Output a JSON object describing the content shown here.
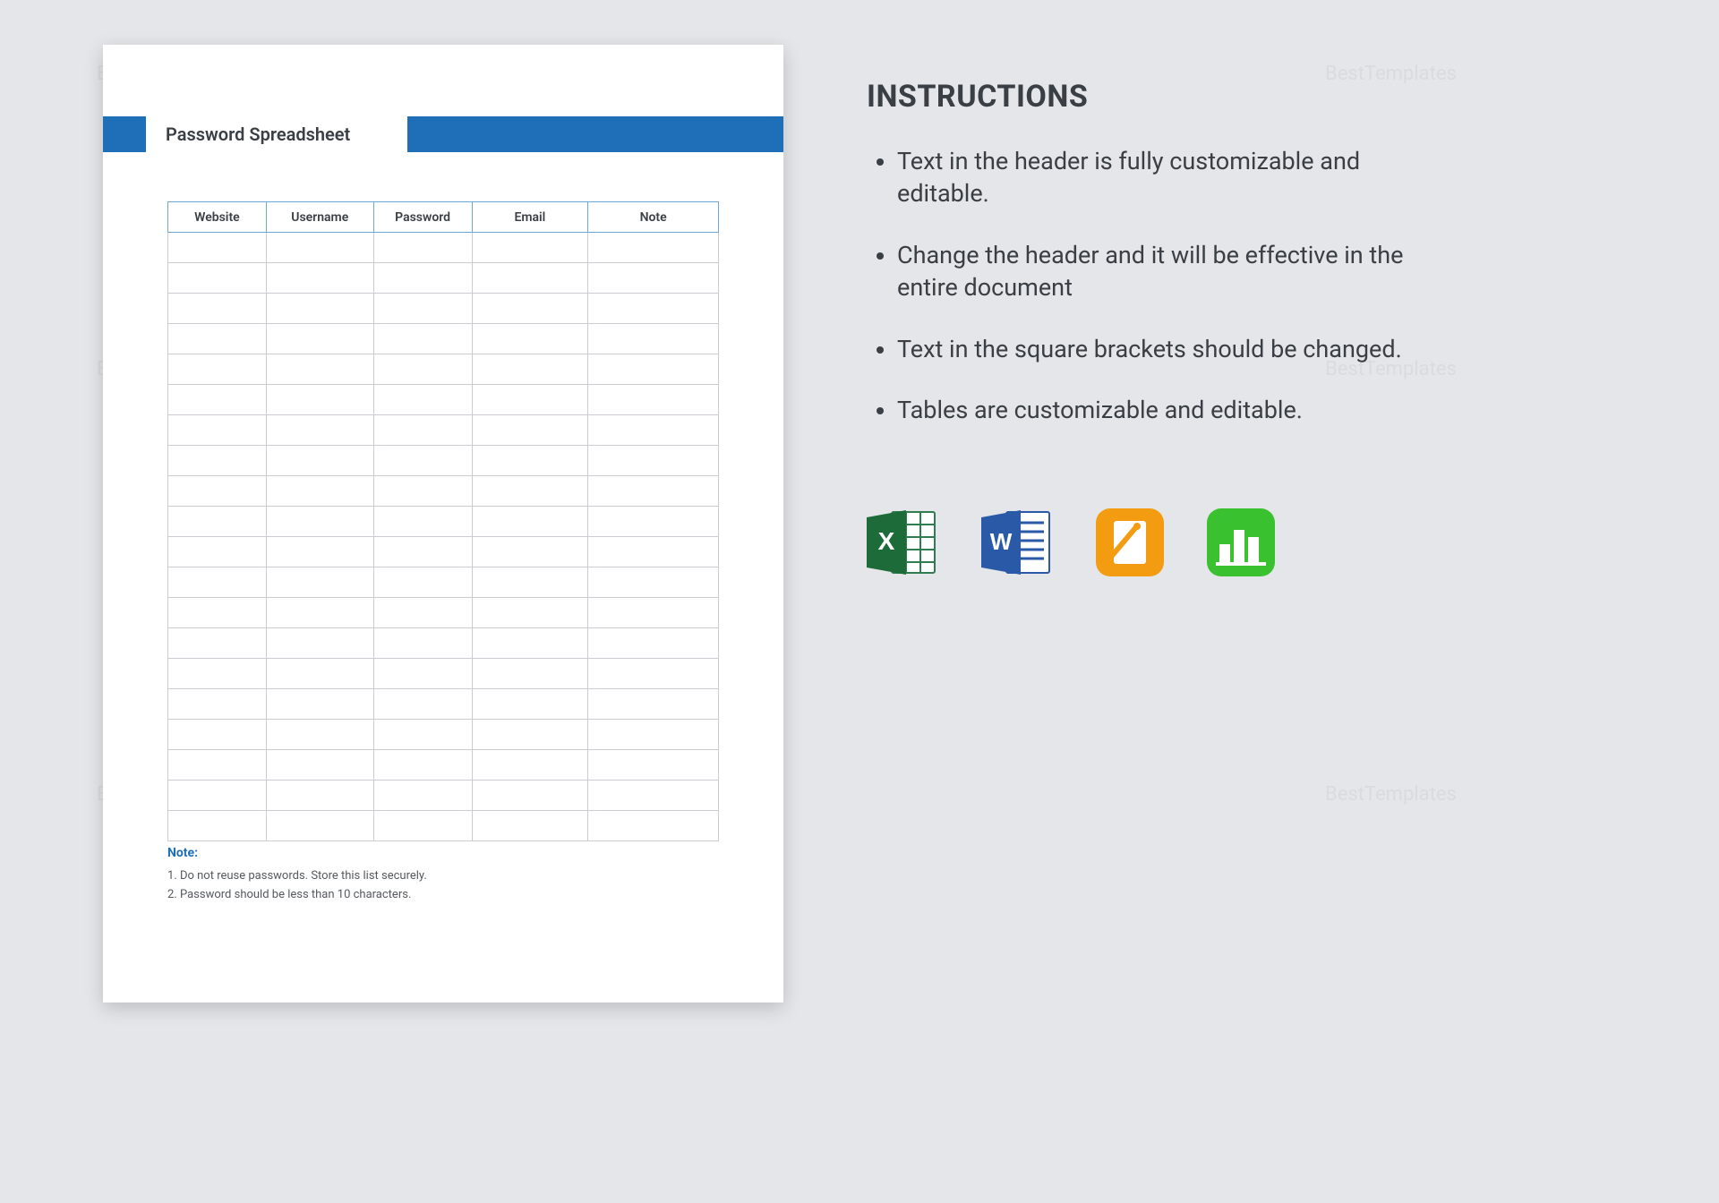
{
  "watermark_text": "BestTemplates",
  "document": {
    "title": "Password Spreadsheet",
    "columns": [
      "Website",
      "Username",
      "Password",
      "Email",
      "Note"
    ],
    "empty_rows": 20,
    "note_label": "Note:",
    "notes": [
      "1. Do not reuse passwords. Store this list securely.",
      "2. Password should be less than 10 characters."
    ]
  },
  "instructions": {
    "heading": "INSTRUCTIONS",
    "items": [
      "Text in the header is fully customizable and editable.",
      "Change the header and it will be effective in the entire document",
      "Text in the square brackets should be changed.",
      "Tables are customizable and editable."
    ]
  },
  "app_icons": [
    "excel-icon",
    "word-icon",
    "pages-icon",
    "numbers-icon"
  ]
}
